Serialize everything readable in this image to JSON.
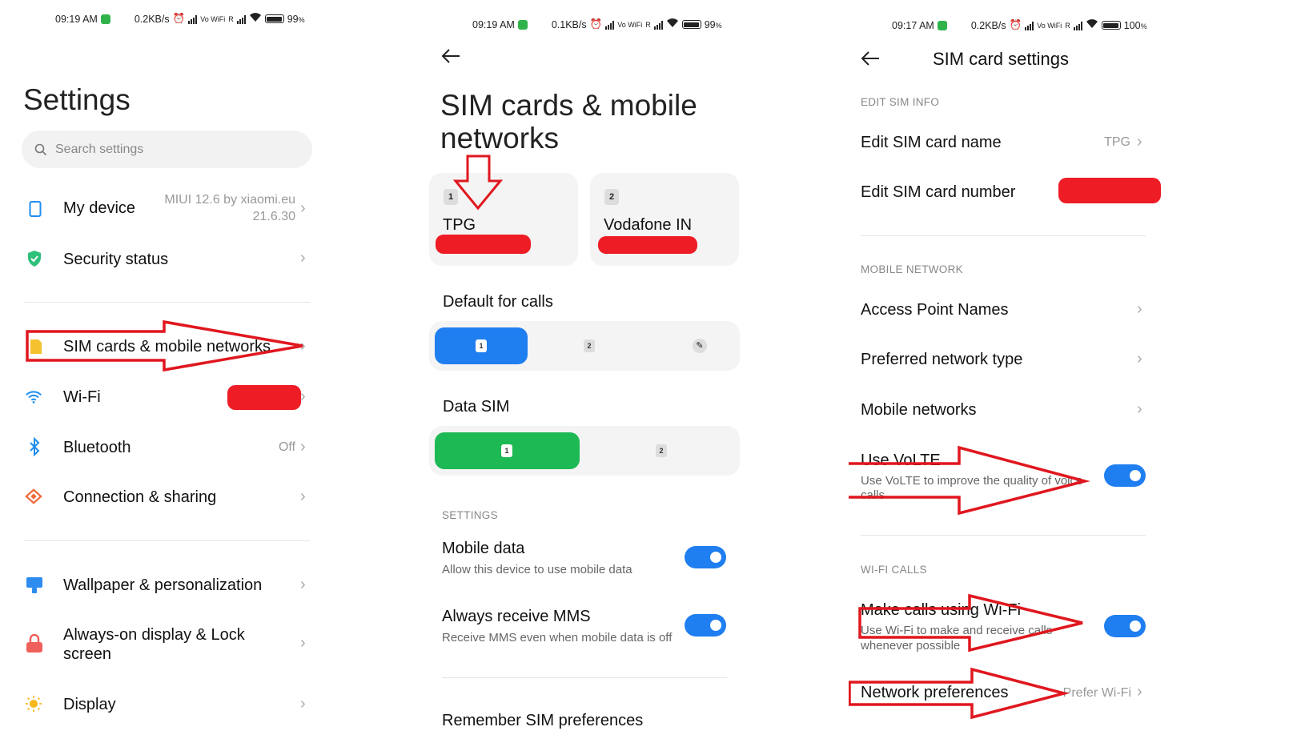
{
  "colors": {
    "accent": "#1f7ef0",
    "data_sim": "#1db954",
    "annotation": "#e0171f",
    "redaction": "#ee1c25"
  },
  "panel1": {
    "status": {
      "time": "09:19 AM",
      "speed": "0.2KB/s",
      "battery": "99",
      "battery_unit": "%",
      "vo_wifi": "Vo WiFi",
      "roaming": "R"
    },
    "title": "Settings",
    "search": {
      "icon": "search-icon",
      "placeholder": "Search settings"
    },
    "items": [
      {
        "icon": "phone-icon",
        "label": "My device",
        "value": "MIUI 12.6 by xiaomi.eu",
        "value2": "21.6.30"
      },
      {
        "icon": "shield-check-icon",
        "label": "Security status"
      },
      {
        "icon": "sim-card-icon",
        "label": "SIM cards & mobile networks"
      },
      {
        "icon": "wifi-icon",
        "label": "Wi-Fi"
      },
      {
        "icon": "bluetooth-icon",
        "label": "Bluetooth",
        "value": "Off"
      },
      {
        "icon": "connection-sharing-icon",
        "label": "Connection & sharing"
      },
      {
        "icon": "wallpaper-icon",
        "label": "Wallpaper & personalization"
      },
      {
        "icon": "lock-icon",
        "label": "Always-on display & Lock",
        "label2": "screen"
      },
      {
        "icon": "brightness-icon",
        "label": "Display"
      }
    ]
  },
  "panel2": {
    "status": {
      "time": "09:19 AM",
      "speed": "0.1KB/s",
      "battery": "99",
      "battery_unit": "%"
    },
    "title_line1": "SIM cards & mobile",
    "title_line2": "networks",
    "sims": [
      {
        "slot": "1",
        "name": "TPG"
      },
      {
        "slot": "2",
        "name": "Vodafone IN"
      }
    ],
    "default_calls": {
      "label": "Default for calls",
      "options": [
        "1",
        "2"
      ],
      "selected": "1"
    },
    "data_sim": {
      "label": "Data SIM",
      "options": [
        "1",
        "2"
      ],
      "selected": "1"
    },
    "section": "SETTINGS",
    "mobile_data": {
      "title": "Mobile data",
      "subtitle": "Allow this device to use mobile data",
      "enabled": true
    },
    "mms": {
      "title": "Always receive MMS",
      "subtitle": "Receive MMS even when mobile data is off",
      "enabled": true
    },
    "remember": "Remember SIM preferences"
  },
  "panel3": {
    "status": {
      "time": "09:17 AM",
      "speed": "0.2KB/s",
      "battery": "100",
      "battery_unit": "%"
    },
    "title": "SIM card settings",
    "section_edit": "EDIT SIM INFO",
    "edit_name": {
      "label": "Edit SIM card name",
      "value": "TPG"
    },
    "edit_number": {
      "label": "Edit SIM card number"
    },
    "section_mobile": "MOBILE NETWORK",
    "apn": "Access Point Names",
    "preferred": "Preferred network type",
    "mobile_networks": "Mobile networks",
    "volte": {
      "title": "Use VoLTE",
      "subtitle": "Use VoLTE to improve the quality of voice",
      "subtitle2": "calls",
      "enabled": true
    },
    "section_wifi": "WI-FI CALLS",
    "wifi_calls": {
      "title": "Make calls using Wi-Fi",
      "subtitle": "Use Wi-Fi to make and receive calls",
      "subtitle2": "whenever possible",
      "enabled": true
    },
    "net_pref": {
      "label": "Network preferences",
      "value": "Prefer Wi-Fi"
    }
  }
}
